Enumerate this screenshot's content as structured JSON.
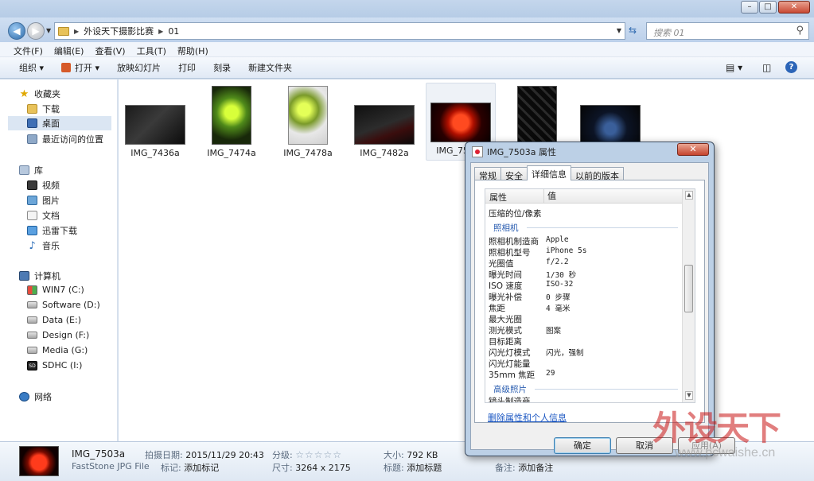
{
  "window": {
    "controls": {
      "minimize": "–",
      "maximize": "□",
      "close": "✕"
    }
  },
  "address": {
    "path": [
      "外设天下摄影比赛",
      "01"
    ],
    "search_placeholder": "搜索 01"
  },
  "menu": [
    "文件(F)",
    "编辑(E)",
    "查看(V)",
    "工具(T)",
    "帮助(H)"
  ],
  "toolbar": {
    "organize": "组织 ▾",
    "open": "打开 ▾",
    "slideshow": "放映幻灯片",
    "print": "打印",
    "burn": "刻录",
    "new_folder": "新建文件夹"
  },
  "nav": {
    "favorites": "收藏夹",
    "downloads": "下载",
    "desktop": "桌面",
    "recent": "最近访问的位置",
    "libraries": "库",
    "videos": "视频",
    "pictures": "图片",
    "documents": "文档",
    "thunder": "迅雷下载",
    "music": "音乐",
    "computer": "计算机",
    "drive_c": "WIN7 (C:)",
    "drive_d": "Software (D:)",
    "drive_e": "Data (E:)",
    "drive_f": "Design (F:)",
    "drive_g": "Media (G:)",
    "drive_i": "SDHC (I:)",
    "network": "网络"
  },
  "files": [
    {
      "name": "IMG_7436a"
    },
    {
      "name": "IMG_7474a"
    },
    {
      "name": "IMG_7478a"
    },
    {
      "name": "IMG_7482a"
    },
    {
      "name": "IMG_7503a"
    },
    {
      "name": ""
    },
    {
      "name": ""
    }
  ],
  "details": {
    "name": "IMG_7503a",
    "type": "FastStone JPG File",
    "date_label": "拍摄日期:",
    "date": "2015/11/29 20:43",
    "tags_label": "标记:",
    "tags": "添加标记",
    "rating_label": "分级:",
    "rating": "☆☆☆☆☆",
    "dims_label": "尺寸:",
    "dims": "3264 x 2175",
    "size_label": "大小:",
    "size": "792 KB",
    "title_label": "标题:",
    "title": "添加标题",
    "comments_label": "备注:",
    "comments": "添加备注"
  },
  "dialog": {
    "title": "IMG_7503a 属性",
    "close": "✕",
    "tabs": [
      "常规",
      "安全",
      "详细信息",
      "以前的版本"
    ],
    "col_prop": "属性",
    "col_val": "值",
    "row_compress": "压缩的位/像素",
    "section_camera": "照相机",
    "rows": [
      {
        "k": "照相机制造商",
        "v": "Apple"
      },
      {
        "k": "照相机型号",
        "v": "iPhone 5s"
      },
      {
        "k": "光圈值",
        "v": "f/2.2"
      },
      {
        "k": "曝光时间",
        "v": "1/30 秒"
      },
      {
        "k": "ISO 速度",
        "v": "ISO-32"
      },
      {
        "k": "曝光补偿",
        "v": "0 步骤"
      },
      {
        "k": "焦距",
        "v": "4 毫米"
      },
      {
        "k": "最大光圈",
        "v": ""
      },
      {
        "k": "测光模式",
        "v": "图案"
      },
      {
        "k": "目标距离",
        "v": ""
      },
      {
        "k": "闪光灯模式",
        "v": "闪光，强制"
      },
      {
        "k": "闪光灯能量",
        "v": ""
      },
      {
        "k": "35mm 焦距",
        "v": "29"
      }
    ],
    "section_advanced": "高级照片",
    "row_cut": "镜头制造商",
    "remove_link": "删除属性和个人信息",
    "ok": "确定",
    "cancel": "取消",
    "apply": "应用(A)"
  },
  "watermark": {
    "text": "外设天下",
    "url": "www.pcwaishe.cn"
  }
}
